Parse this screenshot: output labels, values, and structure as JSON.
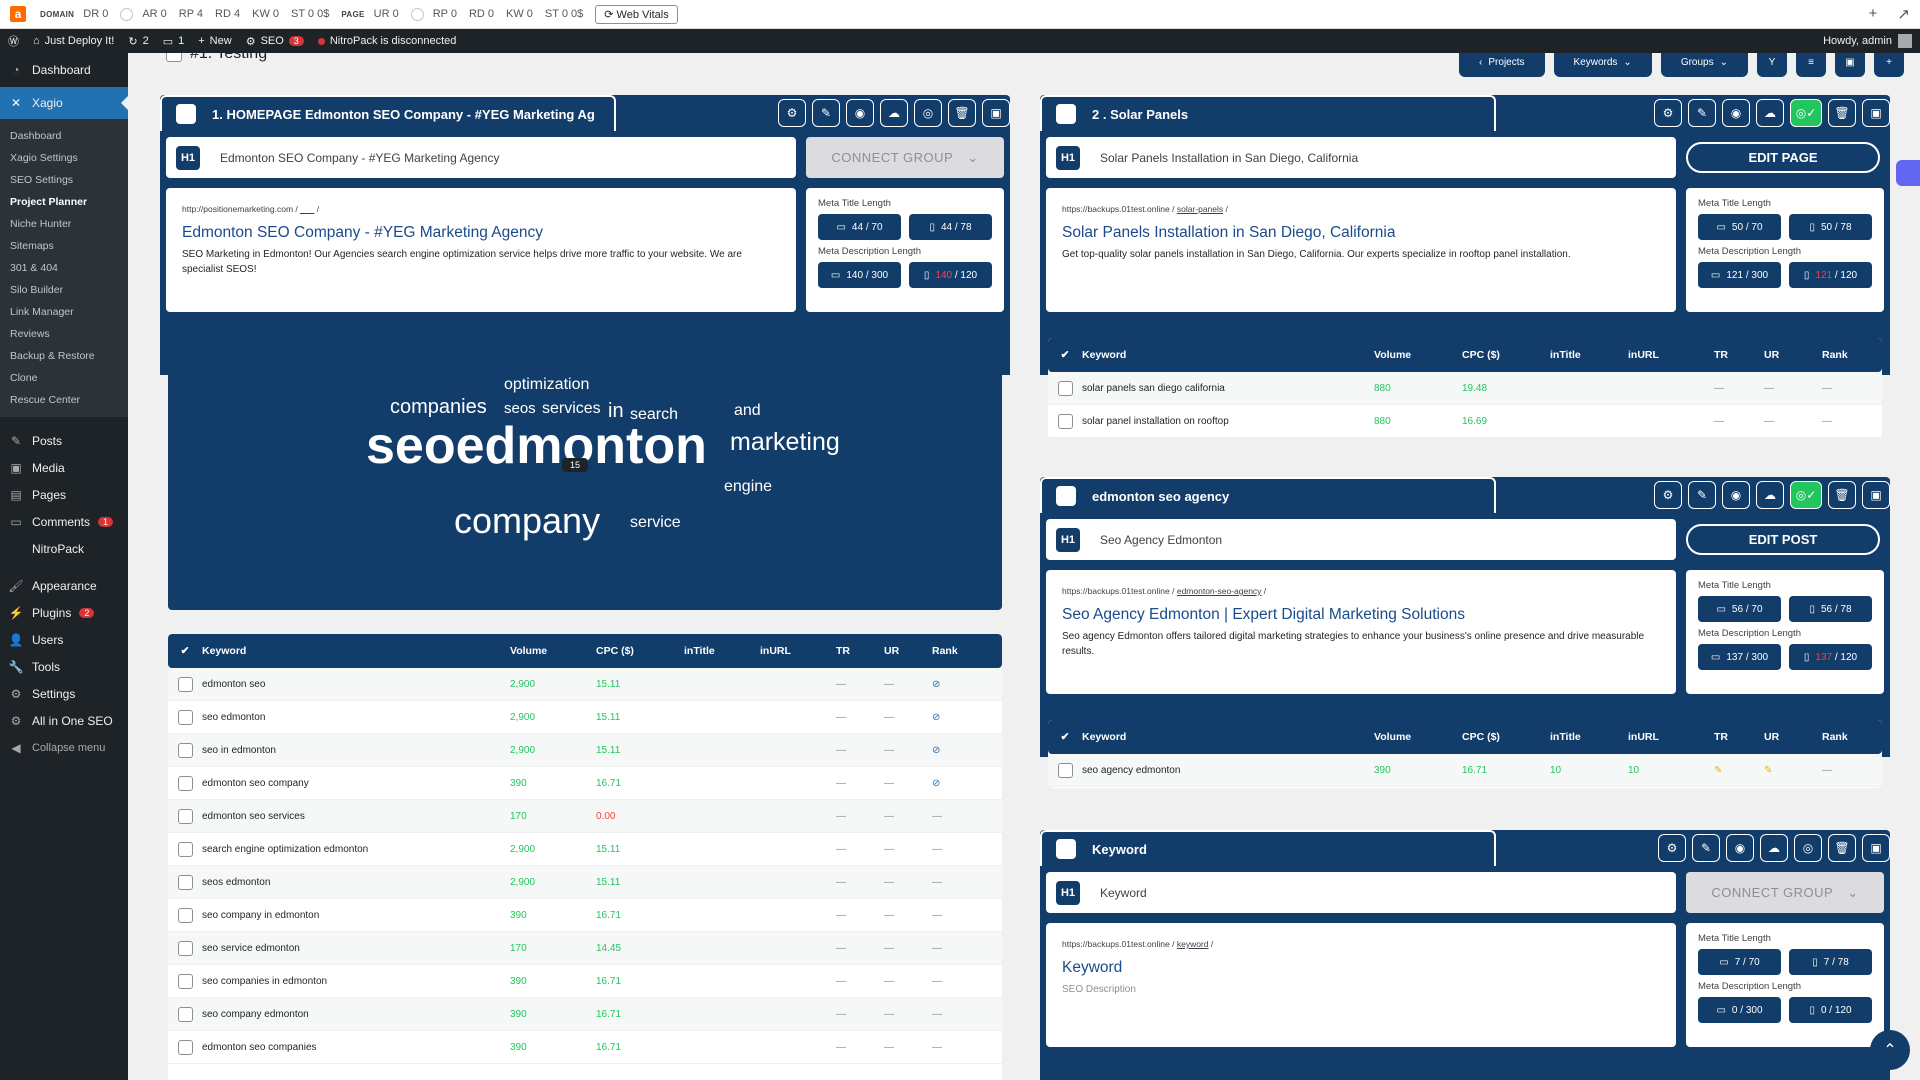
{
  "seobar": {
    "domain_label": "DOMAIN",
    "domain_metrics": [
      "DR 0",
      "AR 0",
      "RP 4",
      "RD 4",
      "KW 0",
      "ST 0 0$"
    ],
    "page_label": "PAGE",
    "page_metrics": [
      "UR 0",
      "RP 0",
      "RD 0",
      "KW 0",
      "ST 0 0$"
    ],
    "web_vitals": "Web Vitals"
  },
  "adminbar": {
    "site": "Just Deploy It!",
    "updates": "2",
    "comments": "1",
    "new": "New",
    "seo": "SEO",
    "seo_badge": "3",
    "nitro": "NitroPack is disconnected",
    "howdy": "Howdy, admin"
  },
  "sidebar": {
    "dashboard": "Dashboard",
    "xagio": "Xagio",
    "subs": [
      "Dashboard",
      "Xagio Settings",
      "SEO Settings",
      "Project Planner",
      "Niche Hunter",
      "Sitemaps",
      "301 & 404",
      "Silo Builder",
      "Link Manager",
      "Reviews",
      "Backup & Restore",
      "Clone",
      "Rescue Center"
    ],
    "posts": "Posts",
    "media": "Media",
    "pages": "Pages",
    "comments": "Comments",
    "comments_badge": "1",
    "nitropack": "NitroPack",
    "appearance": "Appearance",
    "plugins": "Plugins",
    "plugins_badge": "2",
    "users": "Users",
    "tools": "Tools",
    "settings": "Settings",
    "aioseo": "All in One SEO",
    "collapse": "Collapse menu"
  },
  "main": {
    "heading": "#1. Testing",
    "toolbar": {
      "projects": "Projects",
      "keywords": "Keywords",
      "groups": "Groups"
    }
  },
  "groups": [
    {
      "title": "1. HOMEPAGE Edmonton SEO Company - #YEG Marketing Ag",
      "h1": "Edmonton SEO Company - #YEG Marketing Agency",
      "action": "CONNECT GROUP",
      "url": "http://positionemarketing.com /",
      "slug": "___",
      "seo_title": "Edmonton SEO Company - #YEG Marketing Agency",
      "seo_desc": "SEO Marketing in Edmonton! Our Agencies search engine optimization service helps drive more traffic to your website. We are specialist SEOS!",
      "meta_title_label": "Meta Title Length",
      "meta_desc_label": "Meta Description Length",
      "mt_desktop": "44 / 70",
      "mt_mobile": "44 / 78",
      "md_desktop": "140 / 300",
      "md_mobile_a": "140",
      "md_mobile_b": " / 120"
    },
    {
      "title": "2 . Solar Panels",
      "h1": "Solar Panels Installation in San Diego, California",
      "action": "EDIT PAGE",
      "url": "https://backups.01test.online /",
      "slug": "solar-panels",
      "seo_title": "Solar Panels Installation in San Diego, California",
      "seo_desc": "Get top-quality solar panels installation in San Diego, California. Our experts specialize in rooftop panel installation.",
      "meta_title_label": "Meta Title Length",
      "meta_desc_label": "Meta Description Length",
      "mt_desktop": "50 / 70",
      "mt_mobile": "50 / 78",
      "md_desktop": "121 / 300",
      "md_mobile_a": "121",
      "md_mobile_b": " / 120"
    },
    {
      "title": "edmonton seo agency",
      "h1": "Seo Agency Edmonton",
      "action": "EDIT POST",
      "url": "https://backups.01test.online /",
      "slug": "edmonton-seo-agency",
      "seo_title": "Seo Agency Edmonton | Expert Digital Marketing Solutions",
      "seo_desc": "Seo agency Edmonton offers tailored digital marketing strategies to enhance your business's online presence and drive measurable results.",
      "meta_title_label": "Meta Title Length",
      "meta_desc_label": "Meta Description Length",
      "mt_desktop": "56 / 70",
      "mt_mobile": "56 / 78",
      "md_desktop": "137 / 300",
      "md_mobile_a": "137",
      "md_mobile_b": " / 120"
    },
    {
      "title": "Keyword",
      "h1": "Keyword",
      "action": "CONNECT GROUP",
      "url": "https://backups.01test.online /",
      "slug": "keyword",
      "seo_title": "Keyword",
      "seo_desc": "SEO Description",
      "meta_title_label": "Meta Title Length",
      "meta_desc_label": "Meta Description Length",
      "mt_desktop": "7 / 70",
      "mt_mobile": "7 / 78",
      "md_desktop": "0 / 300",
      "md_mobile_a": "",
      "md_mobile_b": "0 / 120"
    }
  ],
  "cloud": {
    "words": [
      "optimization",
      "companies",
      "seos",
      "services",
      "in",
      "search",
      "and",
      "seoedmonton",
      "marketing",
      "engine",
      "company",
      "service"
    ],
    "tooltip": "15"
  },
  "table_headers": [
    "Keyword",
    "Volume",
    "CPC ($)",
    "inTitle",
    "inURL",
    "TR",
    "UR",
    "Rank"
  ],
  "table1": [
    {
      "kw": "edmonton seo",
      "vol": "2,900",
      "cpc": "15.11",
      "rank": "icon"
    },
    {
      "kw": "seo edmonton",
      "vol": "2,900",
      "cpc": "15.11",
      "rank": "icon"
    },
    {
      "kw": "seo in edmonton",
      "vol": "2,900",
      "cpc": "15.11",
      "rank": "icon"
    },
    {
      "kw": "edmonton seo company",
      "vol": "390",
      "cpc": "16.71",
      "rank": "icon"
    },
    {
      "kw": "edmonton seo services",
      "vol": "170",
      "cpc": "0.00",
      "rank": "—"
    },
    {
      "kw": "search engine optimization edmonton",
      "vol": "2,900",
      "cpc": "15.11",
      "rank": "—"
    },
    {
      "kw": "seos edmonton",
      "vol": "2,900",
      "cpc": "15.11",
      "rank": "—"
    },
    {
      "kw": "seo company in edmonton",
      "vol": "390",
      "cpc": "16.71",
      "rank": "—"
    },
    {
      "kw": "seo service edmonton",
      "vol": "170",
      "cpc": "14.45",
      "rank": "—"
    },
    {
      "kw": "seo companies in edmonton",
      "vol": "390",
      "cpc": "16.71",
      "rank": "—"
    },
    {
      "kw": "seo company edmonton",
      "vol": "390",
      "cpc": "16.71",
      "rank": "—"
    },
    {
      "kw": "edmonton seo companies",
      "vol": "390",
      "cpc": "16.71",
      "rank": "—"
    }
  ],
  "table2": [
    {
      "kw": "solar panels san diego california",
      "vol": "880",
      "cpc": "19.48"
    },
    {
      "kw": "solar panel installation on rooftop",
      "vol": "880",
      "cpc": "16.69"
    }
  ],
  "table3": [
    {
      "kw": "seo agency edmonton",
      "vol": "390",
      "cpc": "16.71",
      "intitle": "10",
      "inurl": "10"
    }
  ],
  "dash": "—"
}
